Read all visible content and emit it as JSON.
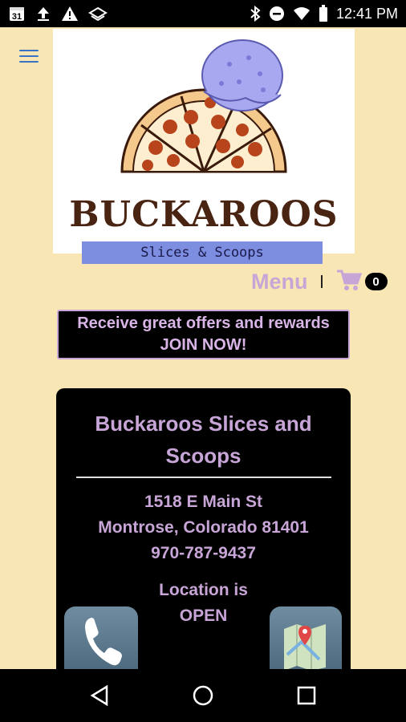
{
  "status_bar": {
    "calendar_day": "31",
    "time": "12:41 PM",
    "icons_left": [
      "calendar-icon",
      "upload-icon",
      "warning-icon",
      "layers-icon"
    ],
    "icons_right": [
      "bluetooth-icon",
      "do-not-disturb-icon",
      "wifi-icon",
      "battery-icon"
    ]
  },
  "header": {
    "menu_icon": "hamburger-menu-icon",
    "logo": {
      "name": "BUCKAROOS",
      "tagline": "Slices & Scoops",
      "colors": {
        "name": "#4a2412",
        "band": "#7d8de0",
        "scoop": "#a8a8f0",
        "pepperoni": "#b8441c"
      }
    }
  },
  "menu_row": {
    "menu_label": "Menu",
    "cart_icon": "shopping-cart-icon",
    "cart_count": "0"
  },
  "promo": {
    "line1": "Receive great offers and rewards",
    "line2": "JOIN NOW!"
  },
  "location": {
    "name": "Buckaroos Slices and Scoops",
    "street": "1518 E Main St",
    "city": "Montrose, Colorado 81401",
    "phone": "970-787-9437",
    "status_label": "Location is",
    "status": "OPEN"
  },
  "action_buttons": {
    "call_icon": "phone-icon",
    "map_icon": "map-icon"
  },
  "nav_bar": {
    "back": "back-icon",
    "home": "home-icon",
    "recents": "recents-icon"
  },
  "theme": {
    "background": "#f8e7b4",
    "accent": "#c7a5d6",
    "card": "#000000"
  }
}
